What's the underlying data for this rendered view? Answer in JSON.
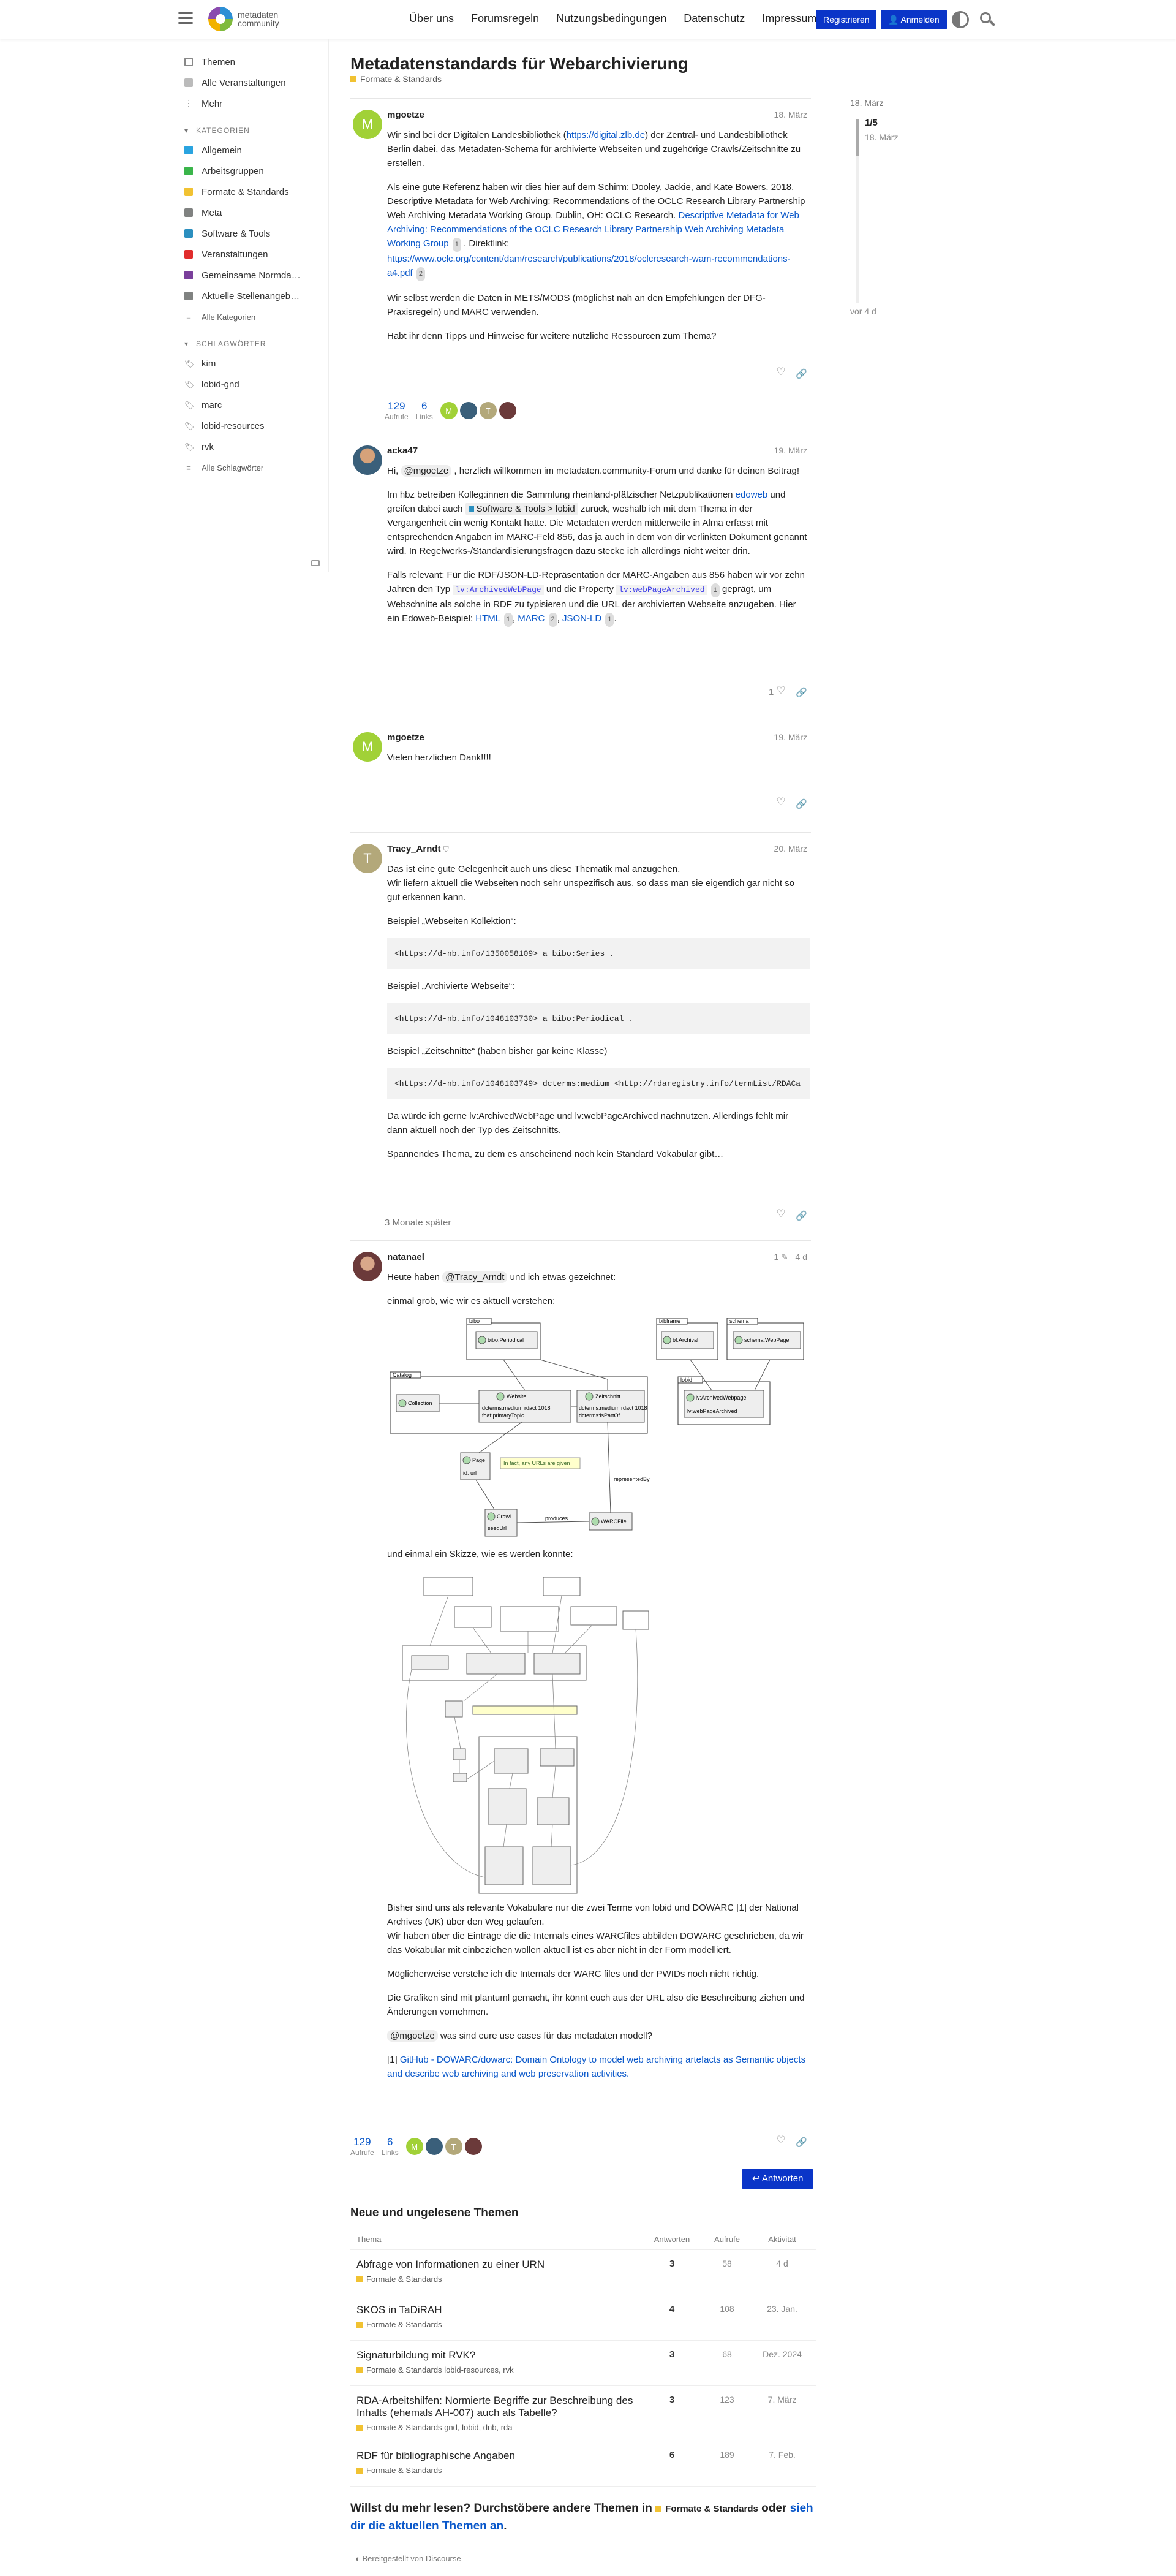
{
  "header": {
    "logo_line1": "metadaten",
    "logo_line2": "community",
    "nav": [
      "Über uns",
      "Forumsregeln",
      "Nutzungsbedingungen",
      "Datenschutz",
      "Impressum"
    ],
    "register": "Registrieren",
    "login": "Anmelden"
  },
  "sidebar": {
    "top": [
      {
        "label": "Themen",
        "icon": "topics-icon"
      },
      {
        "label": "Alle Veranstaltungen",
        "icon": "calendar-icon"
      },
      {
        "label": "Mehr",
        "icon": "more-icon"
      }
    ],
    "cat_title": "Kategorien",
    "categories": [
      {
        "label": "Allgemein",
        "color": "#2aa4e0"
      },
      {
        "label": "Arbeitsgruppen",
        "color": "#3ab54a"
      },
      {
        "label": "Formate & Standards",
        "color": "#f1c232"
      },
      {
        "label": "Meta",
        "color": "#808281"
      },
      {
        "label": "Software & Tools",
        "color": "#2b8fbf"
      },
      {
        "label": "Veranstaltungen",
        "color": "#e02c2c"
      },
      {
        "label": "Gemeinsame Normda…",
        "color": "#7a3f9b"
      },
      {
        "label": "Aktuelle Stellenangeb…",
        "color": "#808281"
      }
    ],
    "all_cats": "Alle Kategorien",
    "tag_title": "Schlagwörter",
    "tags": [
      "kim",
      "lobid-gnd",
      "marc",
      "lobid-resources",
      "rvk"
    ],
    "all_tags": "Alle Schlagwörter"
  },
  "topic": {
    "title": "Metadatenstandards für Webarchivierung",
    "category": "Formate & Standards",
    "category_color": "#f1c232"
  },
  "posts": [
    {
      "user": "mgoetze",
      "avatar_letter": "M",
      "avatar_color": "#a1d137",
      "date": "18. März",
      "p1a": "Wir sind bei der Digitalen Landesbibliothek (",
      "p1link": "https://digital.zlb.de",
      "p1b": ") der Zentral- und Landesbibliothek Berlin dabei, das Metadaten-Schema für archivierte Webseiten und zugehörige Crawls/Zeitschnitte zu erstellen.",
      "p2a": "Als eine gute Referenz haben wir dies hier auf dem Schirm: Dooley, Jackie, and Kate Bowers. 2018. Descriptive Metadata for Web Archiving: Recommendations of the OCLC Research Library Partnership Web Archiving Metadata Working Group. Dublin, OH: OCLC Research. ",
      "p2link": "Descriptive Metadata for Web Archiving: Recommendations of the OCLC Research Library Partnership Web Archiving Metadata Working Group",
      "p2n": "1",
      "p2b": " . Direktlink: ",
      "p2link2": "https://www.oclc.org/content/dam/research/publications/2018/oclcresearch-wam-recommendations-a4.pdf",
      "p2n2": "2",
      "p3": "Wir selbst werden die Daten in METS/MODS (möglichst nah an den Empfehlungen der DFG-Praxisregeln) und MARC verwenden.",
      "p4": "Habt ihr denn Tipps und Hinweise für weitere nützliche Ressourcen zum Thema?"
    },
    {
      "user": "acka47",
      "date": "19. März",
      "likes": "1",
      "p1a": "Hi, ",
      "mention": "@mgoetze",
      "p1b": " , herzlich willkommen im metadaten.community-Forum und danke für deinen Beitrag!",
      "p2a": "Im hbz betreiben Kolleg:innen die Sammlung rheinland-pfälzischer Netzpublikationen ",
      "p2link": "edoweb",
      "p2b": " und greifen dabei auch ",
      "p2tag": "Software & Tools > lobid",
      "p2c": " zurück, weshalb ich mit dem Thema in der Vergangenheit ein wenig Kontakt hatte. Die Metadaten werden mittlerweile in Alma erfasst mit entsprechenden Angaben im MARC-Feld 856, das ja auch in dem von dir verlinkten Dokument genannt wird. In Regelwerks-/Standardisierungsfragen dazu stecke ich allerdings nicht weiter drin.",
      "p3a": "Falls relevant: Für die RDF/JSON-LD-Repräsentation der MARC-Angaben aus 856 haben wir vor zehn Jahren den Typ ",
      "code1": "lv:ArchivedWebPage",
      "p3b": " und die Property ",
      "code2": "lv:webPageArchived",
      "n1": "1",
      "p3c": " geprägt, um Webschnitte als solche in RDF zu typisieren und die URL der archivierten Webseite anzugeben. Hier ein Edoweb-Beispiel: ",
      "l1": "HTML",
      "l1n": "1",
      "l2": "MARC",
      "l2n": "2",
      "l3": "JSON-LD",
      "l3n": "1"
    },
    {
      "user": "mgoetze",
      "avatar_letter": "M",
      "avatar_color": "#a1d137",
      "date": "19. März",
      "p1": "Vielen herzlichen Dank!!!!"
    },
    {
      "user": "Tracy_Arndt",
      "avatar_letter": "T",
      "avatar_color": "#b3a87a",
      "date": "20. März",
      "p1": "Das ist eine gute Gelegenheit auch uns diese Thematik mal anzugehen.",
      "p1b": "Wir liefern aktuell die Webseiten noch sehr unspezifisch aus, so dass man sie eigentlich gar nicht so gut erkennen kann.",
      "ex1": "Beispiel „Webseiten Kollektion“:",
      "code1": "<https://d-nb.info/1350058109> a bibo:Series .",
      "ex2": "Beispiel „Archivierte Webseite“:",
      "code2": "<https://d-nb.info/1048103730> a bibo:Periodical .",
      "ex3": "Beispiel „Zeitschnitte“ (haben bisher gar keine Klasse)",
      "code3": "<https://d-nb.info/1048103749> dcterms:medium <http://rdaregistry.info/termList/RDACa",
      "p2": "Da würde ich gerne lv:ArchivedWebPage und lv:webPageArchived nachnutzen. Allerdings fehlt mir dann aktuell noch der Typ des Zeitschnitts.",
      "p3": "Spannendes Thema, zu dem es anscheinend noch kein Standard Vokabular gibt…"
    },
    {
      "user": "natanael",
      "date": "4 d",
      "edits": "1",
      "p1a": "Heute haben ",
      "mention": "@Tracy_Arndt",
      "p1b": " und ich etwas gezeichnet:",
      "p2": "einmal grob, wie wir es aktuell verstehen:",
      "p3": "und einmal ein Skizze, wie es werden könnte:",
      "p4": "Bisher sind uns als relevante Vokabulare nur die zwei Terme von lobid und DOWARC [1] der National Archives (UK) über den Weg gelaufen.",
      "p4b": "Wir haben über die Einträge die die Internals eines WARCfiles abbilden DOWARC geschrieben, da wir das Vokabular mit einbeziehen wollen aktuell ist es aber nicht in der Form modelliert.",
      "p5": "Möglicherweise verstehe ich die Internals der WARC files und der PWIDs noch nicht richtig.",
      "p6": "Die Grafiken sind mit plantuml gemacht, ihr könnt euch aus der URL also die Beschreibung ziehen und Änderungen vornehmen.",
      "mention2": "@mgoetze",
      "p7": " was sind eure use cases für das metadaten modell?",
      "ref": "[1] ",
      "reflink": "GitHub - DOWARC/dowarc: Domain Ontology to model web archiving artefacts as Semantic objects and describe web archiving and web preservation activities."
    }
  ],
  "diagram1": {
    "bibo": "bibo",
    "bibo_class": "bibo:Periodical",
    "bibframe": "bibframe",
    "bf_class": "bf:Archival",
    "schema": "schema",
    "schema_class": "schema:WebPage",
    "catalog": "Catalog",
    "collection": "Collection",
    "website": "Website",
    "website_f1": "dcterms:medium rdact 1018",
    "website_f2": "foaf:primaryTopic",
    "zeitschnitt": "Zeitschnitt",
    "zs_f1": "dcterms:medium rdact 1018",
    "zs_f2": "dcterms:isPartOf",
    "lobid": "lobid",
    "lobid_class": "lv:ArchivedWebpage",
    "lobid_f": "lv:webPageArchived",
    "page": "Page",
    "page_f": "id: url",
    "note": "In fact, any URLs are given",
    "crawl": "Crawl",
    "crawl_f": "seedUrl",
    "produces": "produces",
    "warcfile": "WARCFile",
    "represented": "representedBy"
  },
  "gap": "3 Monate später",
  "post1_stats": {
    "views": "129",
    "views_l": "Aufrufe",
    "links": "6",
    "links_l": "Links"
  },
  "timeline": {
    "top": "18. März",
    "pos": "1/5",
    "pdate": "18. März",
    "bottom": "vor 4 d"
  },
  "reply": "Antworten",
  "suggested": {
    "title": "Neue und ungelesene Themen",
    "h_topic": "Thema",
    "h_replies": "Antworten",
    "h_views": "Aufrufe",
    "h_activity": "Aktivität",
    "rows": [
      {
        "title": "Abfrage von Informationen zu einer URN",
        "cat": "Formate & Standards",
        "tags": "",
        "replies": "3",
        "views": "58",
        "activity": "4 d"
      },
      {
        "title": "SKOS in TaDiRAH",
        "cat": "Formate & Standards",
        "tags": "",
        "replies": "4",
        "views": "108",
        "activity": "23. Jan."
      },
      {
        "title": "Signaturbildung mit RVK?",
        "cat": "Formate & Standards",
        "tags": "lobid-resources, rvk",
        "replies": "3",
        "views": "68",
        "activity": "Dez. 2024"
      },
      {
        "title": "RDA-Arbeitshilfen: Normierte Begriffe zur Beschreibung des Inhalts (ehemals AH-007) auch als Tabelle?",
        "sub": "dnb-de",
        "cat": "Formate & Standards",
        "tags": "gnd, lobid, dnb, rda",
        "replies": "3",
        "views": "123",
        "activity": "7. März"
      },
      {
        "title": "RDF für bibliographische Angaben",
        "cat": "Formate & Standards",
        "tags": "",
        "replies": "6",
        "views": "189",
        "activity": "7. Feb."
      }
    ],
    "more1": "Willst du mehr lesen? Durchstöbere andere Themen in ",
    "more_cat": "Formate & Standards",
    "more2": " oder ",
    "more_link": "sieh dir die aktuellen Themen an",
    "more3": "."
  },
  "footer": "Bereitgestellt von Discourse"
}
